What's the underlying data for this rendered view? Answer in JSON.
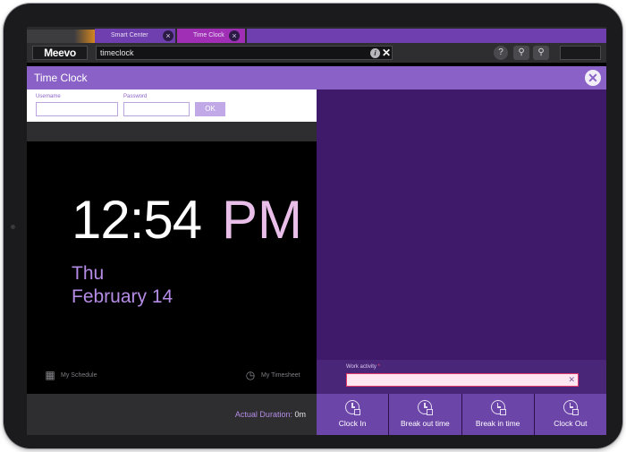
{
  "tabs": [
    {
      "label": "Smart Center"
    },
    {
      "label": "Time Clock"
    }
  ],
  "nav": {
    "logo": "Meevo",
    "search_value": "timeclock",
    "help": "?"
  },
  "page": {
    "title": "Time Clock"
  },
  "login": {
    "username_label": "Username",
    "password_label": "Password",
    "ok_label": "OK"
  },
  "clock": {
    "time": "12:54",
    "ampm": "PM",
    "day": "Thu",
    "date": "February 14"
  },
  "links": {
    "schedule": "My Schedule",
    "timesheet": "My Timesheet"
  },
  "duration": {
    "label": "Actual Duration:",
    "value": "0m"
  },
  "work_activity": {
    "label": "Work activity",
    "required_mark": "*",
    "value": ""
  },
  "actions": [
    {
      "label": "Clock In"
    },
    {
      "label": "Break out time"
    },
    {
      "label": "Break in time"
    },
    {
      "label": "Clock Out"
    }
  ],
  "colors": {
    "accent": "#8a62c7",
    "panel": "#3f1a6b",
    "action": "#6b45a8",
    "ampm": "#e9bfe9"
  }
}
